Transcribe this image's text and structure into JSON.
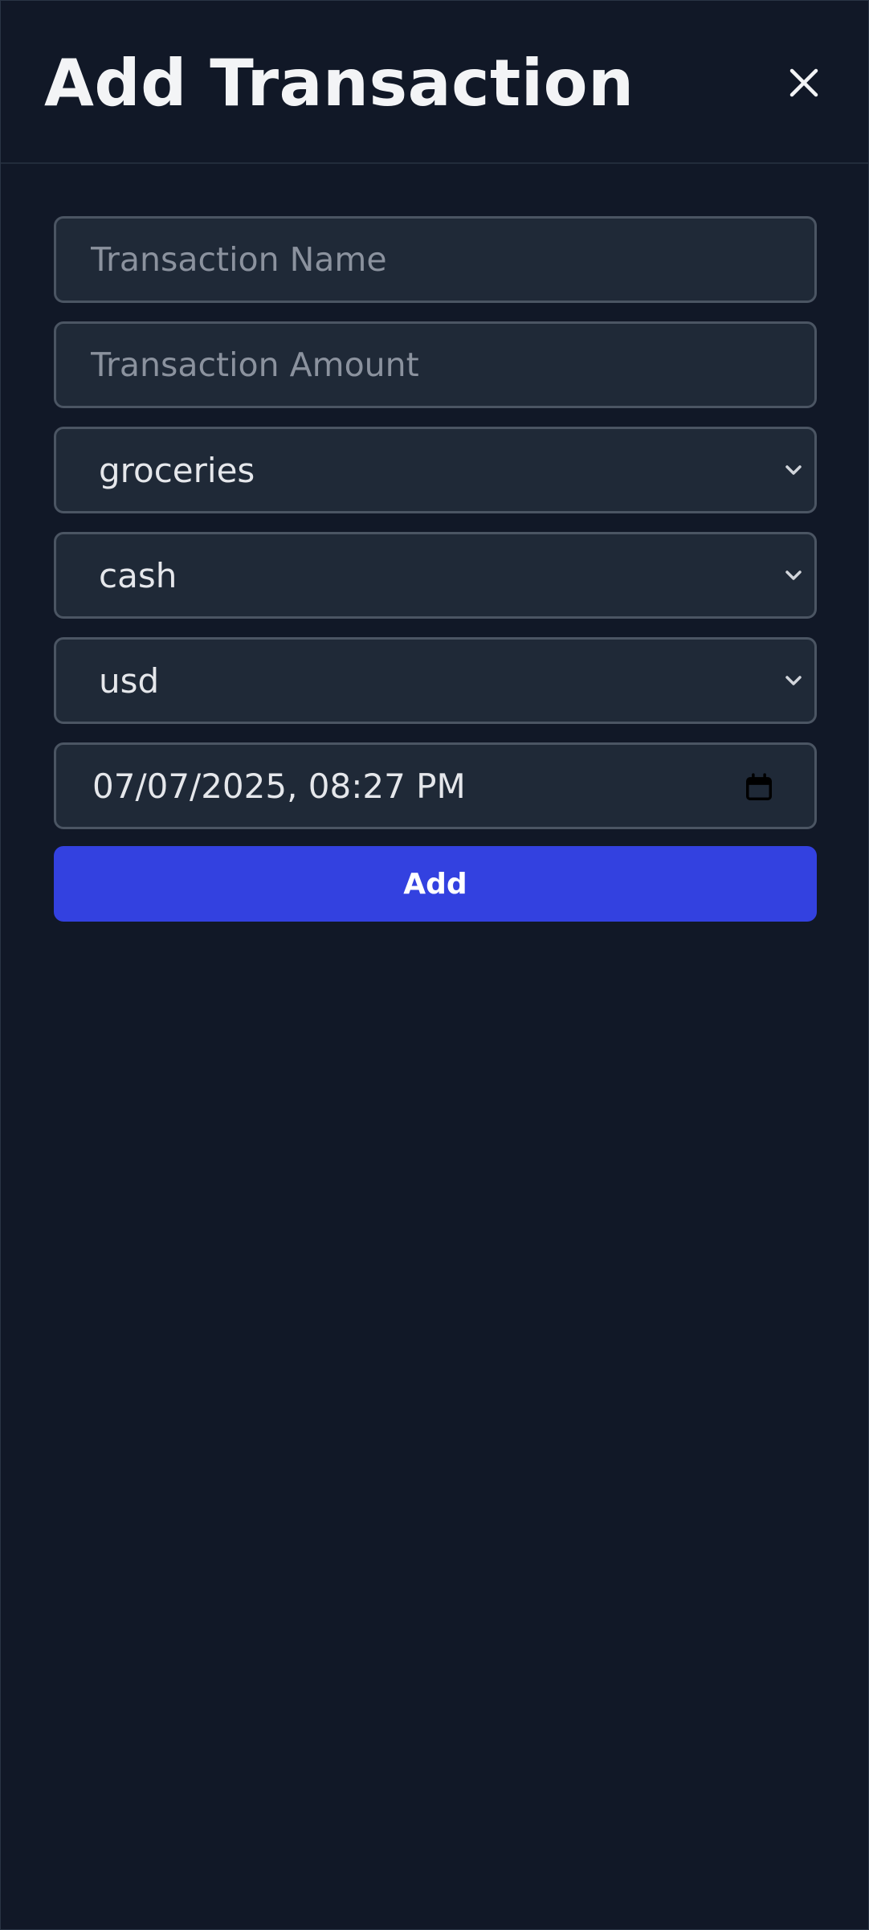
{
  "header": {
    "title": "Add Transaction",
    "close_icon": "close-icon"
  },
  "form": {
    "name_field": {
      "placeholder": "Transaction Name",
      "value": ""
    },
    "amount_field": {
      "placeholder": "Transaction Amount",
      "value": ""
    },
    "category_select": {
      "selected": "groceries",
      "icon": "chevron-down-icon"
    },
    "payment_select": {
      "selected": "cash",
      "icon": "chevron-down-icon"
    },
    "currency_select": {
      "selected": "usd",
      "icon": "chevron-down-icon"
    },
    "datetime_field": {
      "value": "07/07/2025, 08:27 PM",
      "icon": "calendar-icon"
    },
    "submit_label": "Add"
  },
  "colors": {
    "background": "#111827",
    "field_background": "#1f2937",
    "field_border": "#4b5563",
    "accent": "#3341e0",
    "text": "#f3f4f6",
    "placeholder": "#8b929e"
  }
}
